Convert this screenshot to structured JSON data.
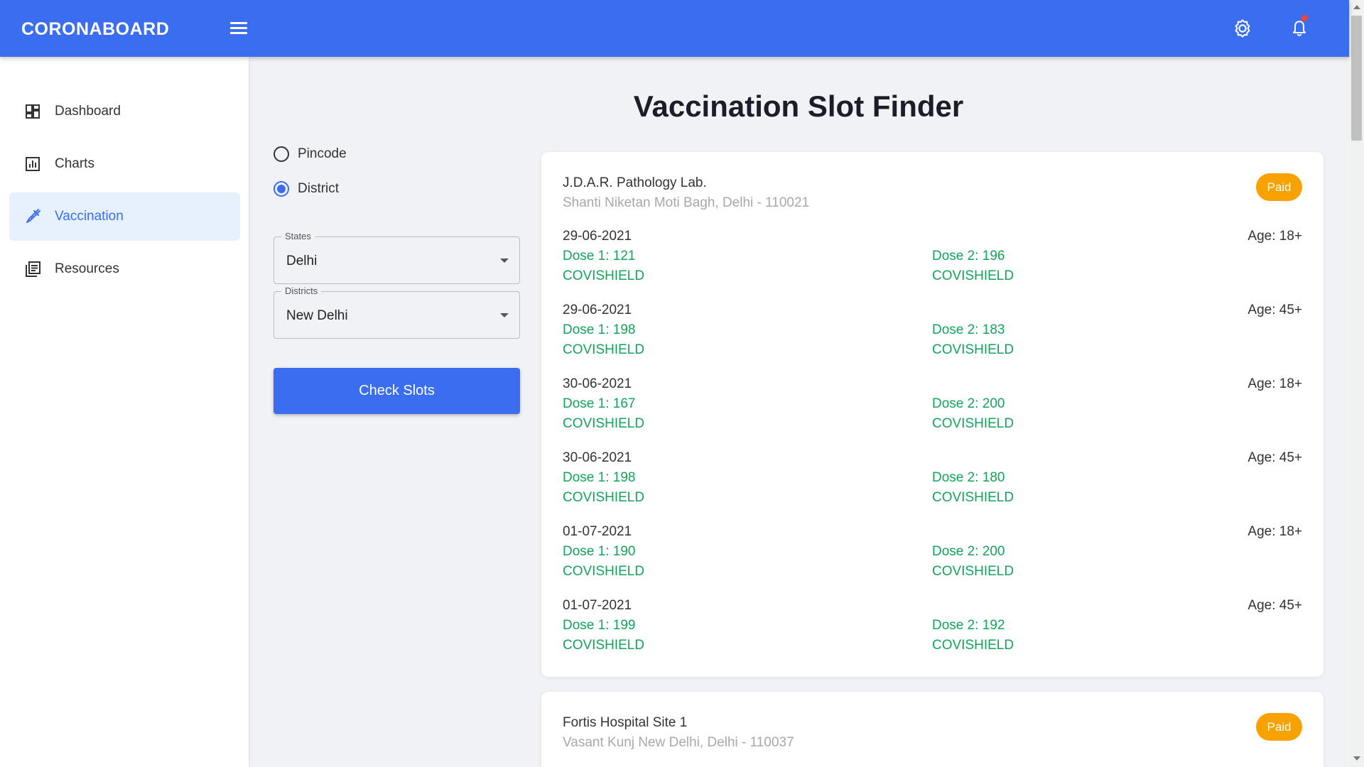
{
  "app": {
    "brand": "CORONABOARD"
  },
  "sidebar": {
    "items": [
      {
        "label": "Dashboard",
        "icon": "dashboard-icon"
      },
      {
        "label": "Charts",
        "icon": "bar-chart-icon"
      },
      {
        "label": "Vaccination",
        "icon": "syringe-icon",
        "active": true
      },
      {
        "label": "Resources",
        "icon": "library-books-icon"
      }
    ]
  },
  "page": {
    "title": "Vaccination Slot Finder"
  },
  "search": {
    "mode_options": [
      "Pincode",
      "District"
    ],
    "selected_mode": "District",
    "state_label": "States",
    "state_value": "Delhi",
    "district_label": "Districts",
    "district_value": "New Delhi",
    "button_label": "Check Slots"
  },
  "colors": {
    "accent": "#3a6df0",
    "available": "#11a55a",
    "paid_badge": "#f7a200",
    "notification": "#f44336"
  },
  "centers": [
    {
      "name": "J.D.A.R. Pathology Lab.",
      "address": "Shanti Niketan Moti Bagh, Delhi - 110021",
      "fee": "Paid",
      "sessions": [
        {
          "date": "29-06-2021",
          "age": "Age: 18+",
          "dose1": "Dose 1: 121",
          "dose2": "Dose 2: 196",
          "vaccine": "COVISHIELD"
        },
        {
          "date": "29-06-2021",
          "age": "Age: 45+",
          "dose1": "Dose 1: 198",
          "dose2": "Dose 2: 183",
          "vaccine": "COVISHIELD"
        },
        {
          "date": "30-06-2021",
          "age": "Age: 18+",
          "dose1": "Dose 1: 167",
          "dose2": "Dose 2: 200",
          "vaccine": "COVISHIELD"
        },
        {
          "date": "30-06-2021",
          "age": "Age: 45+",
          "dose1": "Dose 1: 198",
          "dose2": "Dose 2: 180",
          "vaccine": "COVISHIELD"
        },
        {
          "date": "01-07-2021",
          "age": "Age: 18+",
          "dose1": "Dose 1: 190",
          "dose2": "Dose 2: 200",
          "vaccine": "COVISHIELD"
        },
        {
          "date": "01-07-2021",
          "age": "Age: 45+",
          "dose1": "Dose 1: 199",
          "dose2": "Dose 2: 192",
          "vaccine": "COVISHIELD"
        }
      ]
    },
    {
      "name": "Fortis Hospital Site 1",
      "address": "Vasant Kunj New Delhi, Delhi - 110037",
      "fee": "Paid",
      "sessions": []
    }
  ]
}
